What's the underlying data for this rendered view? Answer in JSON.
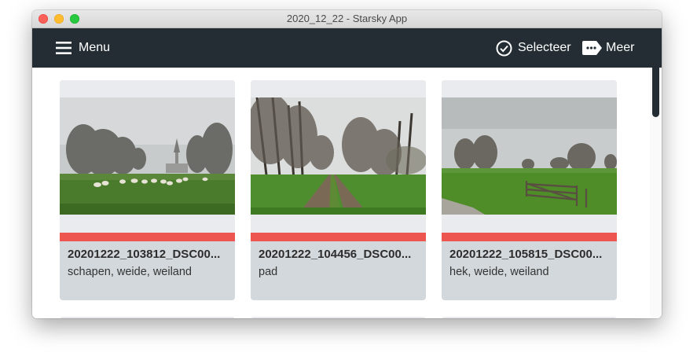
{
  "window": {
    "title": "2020_12_22 - Starsky App"
  },
  "toolbar": {
    "menu_label": "Menu",
    "select_label": "Selecteer",
    "more_label": "Meer"
  },
  "colors": {
    "toolbar_bg": "#232d33",
    "card_bg": "#d3d8dc",
    "label_red": "#ec5550"
  },
  "photos": [
    {
      "filename": "20201222_103812_DSC00...",
      "tags": "schapen, weide, weiland"
    },
    {
      "filename": "20201222_104456_DSC00...",
      "tags": "pad"
    },
    {
      "filename": "20201222_105815_DSC00...",
      "tags": "hek, weide, weiland"
    }
  ]
}
